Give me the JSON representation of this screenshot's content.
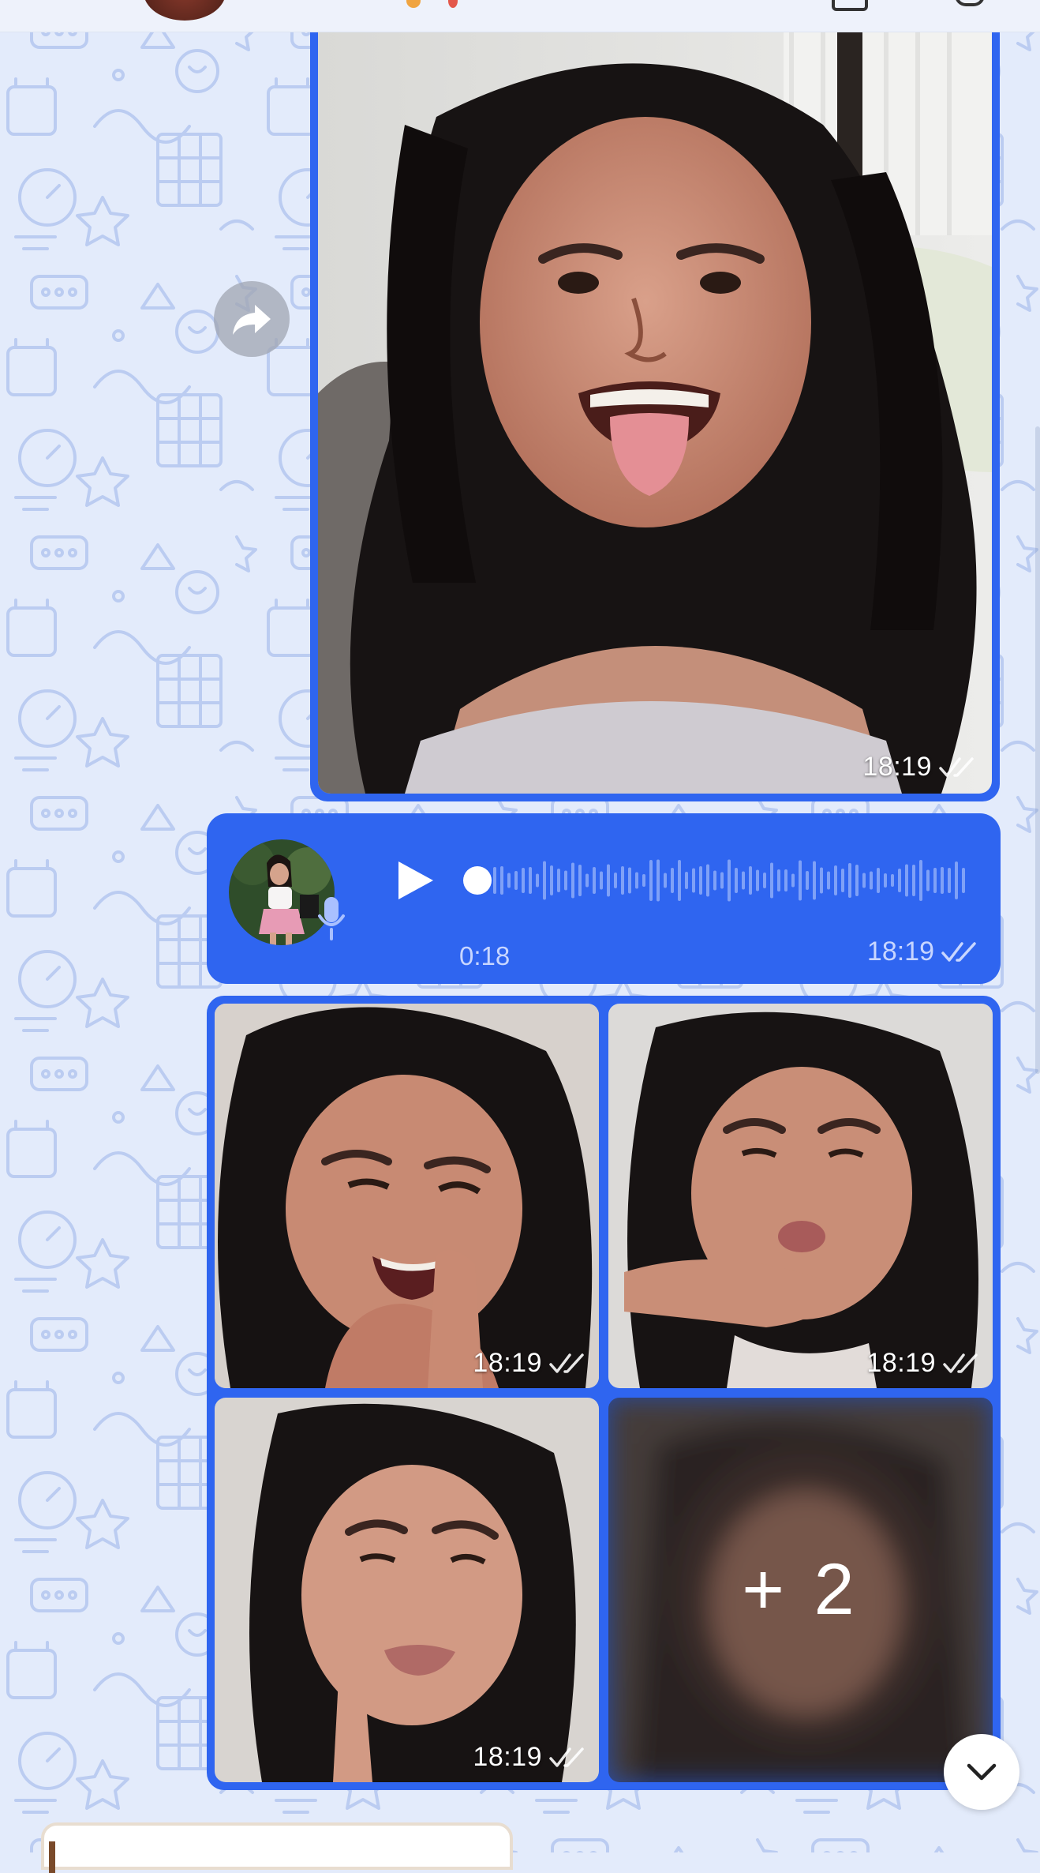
{
  "theme": {
    "wallpaper_bg": "#e3ebfb",
    "wallpaper_doodle": "#b4c6ef",
    "bubble_color": "#2f65f0",
    "meta_text": "#c8d6ff"
  },
  "header": {
    "avatar_icon": "contact-avatar"
  },
  "messages": {
    "photo": {
      "time": "18:19",
      "status_icon": "double-check-icon"
    },
    "share": {
      "icon": "share-arrow-icon"
    },
    "voice": {
      "duration": "0:18",
      "time": "18:19",
      "status_icon": "double-check-icon",
      "progress": 0.0
    },
    "album": {
      "items": [
        {
          "time": "18:19"
        },
        {
          "time": "18:19"
        },
        {
          "time": "18:19"
        },
        {
          "more_label": "+ 2"
        }
      ]
    }
  },
  "scroll_down": {
    "icon": "chevron-down-icon"
  }
}
